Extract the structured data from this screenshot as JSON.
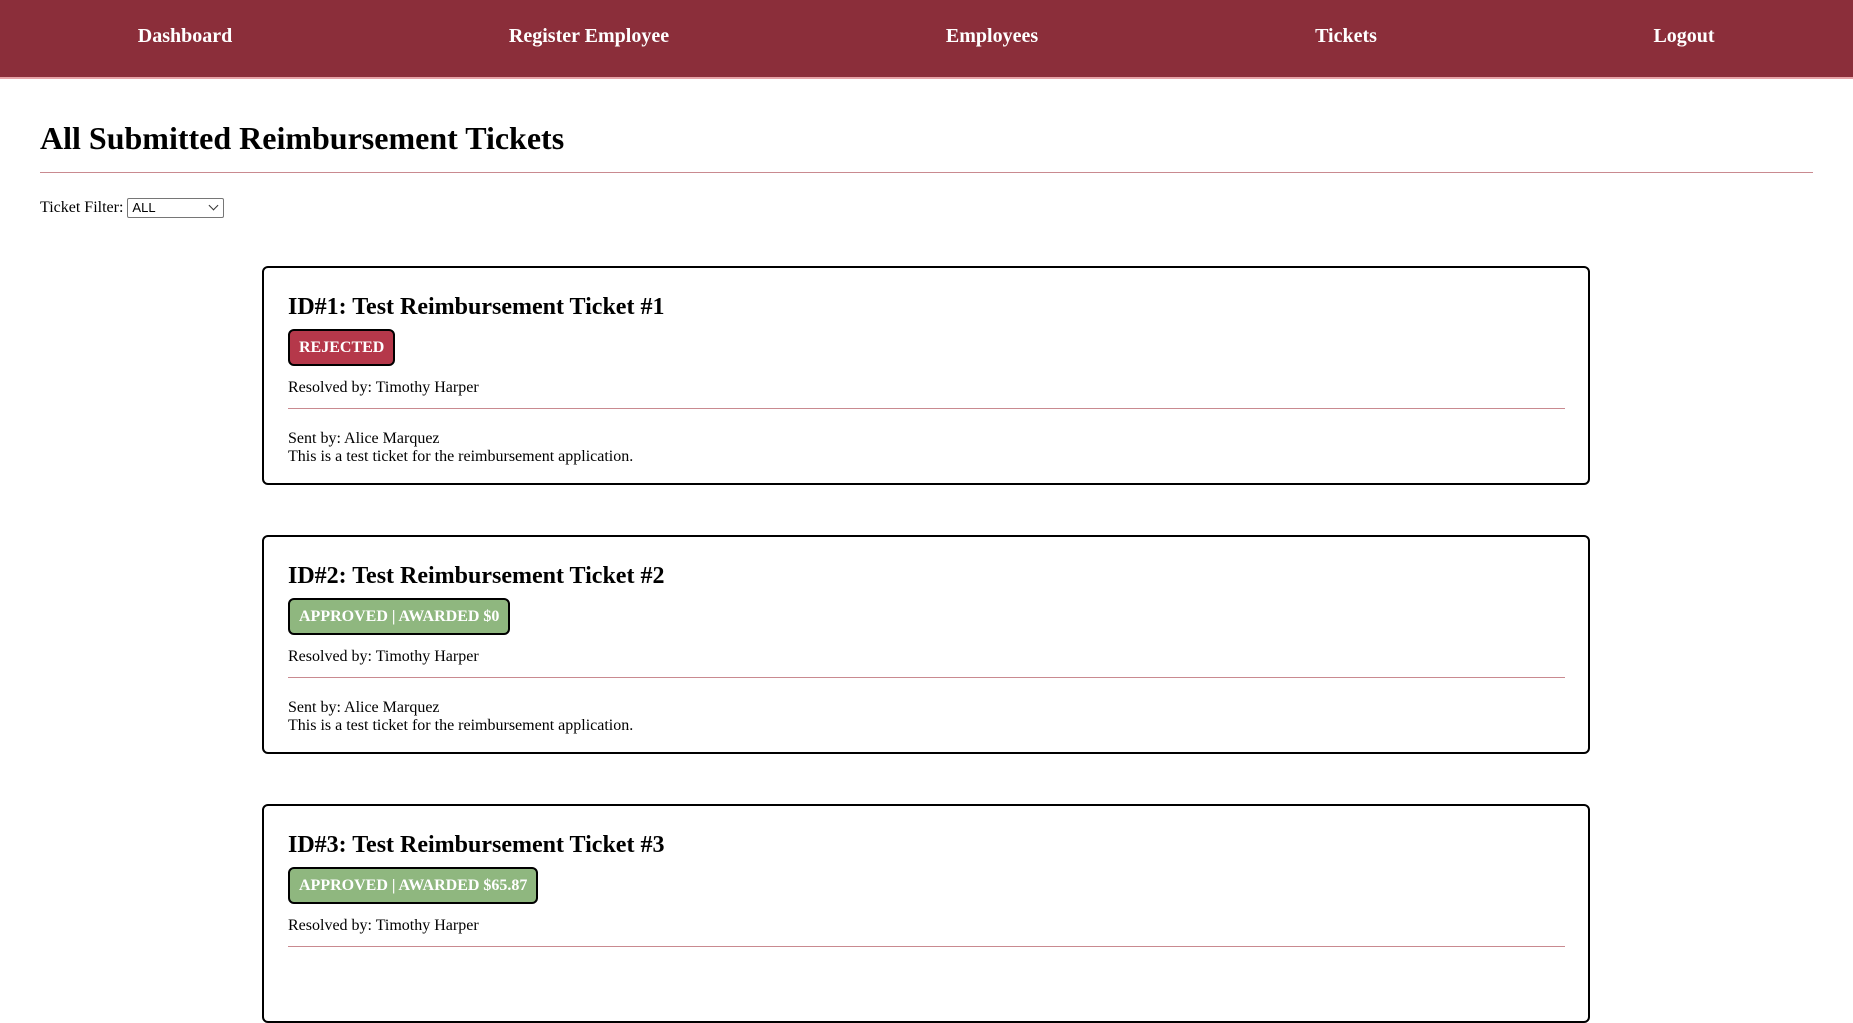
{
  "nav": {
    "items": [
      {
        "label": "Dashboard"
      },
      {
        "label": "Register Employee"
      },
      {
        "label": "Employees"
      },
      {
        "label": "Tickets"
      },
      {
        "label": "Logout"
      }
    ]
  },
  "page": {
    "title": "All Submitted Reimbursement Tickets"
  },
  "filter": {
    "label": "Ticket Filter:",
    "selected": "ALL"
  },
  "tickets": [
    {
      "title": "ID#1: Test Reimbursement Ticket #1",
      "status": "REJECTED",
      "resolved_by": "Resolved by: Timothy Harper",
      "sent_by": "Sent by: Alice Marquez",
      "description": "This is a test ticket for the reimbursement application."
    },
    {
      "title": "ID#2: Test Reimbursement Ticket #2",
      "status": "APPROVED | AWARDED $0",
      "resolved_by": "Resolved by: Timothy Harper",
      "sent_by": "Sent by: Alice Marquez",
      "description": "This is a test ticket for the reimbursement application."
    },
    {
      "title": "ID#3: Test Reimbursement Ticket #3",
      "status": "APPROVED | AWARDED $65.87",
      "resolved_by": "Resolved by: Timothy Harper",
      "sent_by": "",
      "description": ""
    }
  ],
  "colors": {
    "navbar": "#8b2e3a",
    "rejected": "#b5384a",
    "approved": "#8fb77f",
    "divider": "#c98a90"
  }
}
